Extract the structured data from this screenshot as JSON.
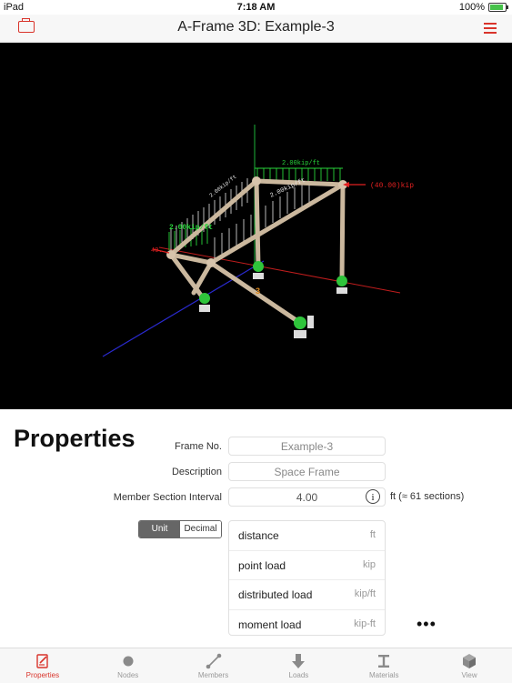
{
  "status_bar": {
    "device": "iPad",
    "time": "7:18 AM",
    "battery": "100%"
  },
  "header": {
    "title": "A-Frame 3D: Example-3",
    "folder_icon": "folder-icon",
    "menu_icon": "hamburger-menu-icon"
  },
  "viewport": {
    "labels": {
      "uniform_load_top": "2.00kip/ft",
      "uniform_load_mid": "2.00kip/ft",
      "uniform_load_left": "2.00kip/ft",
      "left_member_load": "2.00kip/ft",
      "point_load": "(40.00)kip",
      "left_point_load": "40.",
      "member_3": "3"
    }
  },
  "properties": {
    "title": "Properties",
    "frame_no": {
      "label": "Frame No.",
      "value": "Example-3"
    },
    "description": {
      "label": "Description",
      "value": "Space Frame"
    },
    "interval": {
      "label": "Member Section Interval",
      "value": "4.00",
      "info": "i",
      "note": "ft (≈ 61 sections)"
    },
    "format_toggle": {
      "unit": "Unit",
      "decimal": "Decimal",
      "selected": "Unit"
    },
    "units": [
      {
        "name": "distance",
        "unit": "ft"
      },
      {
        "name": "point load",
        "unit": "kip"
      },
      {
        "name": "distributed load",
        "unit": "kip/ft"
      },
      {
        "name": "moment load",
        "unit": "kip-ft"
      }
    ],
    "more": "•••"
  },
  "tabs": [
    {
      "label": "Properties",
      "icon": "edit-document-icon",
      "active": true
    },
    {
      "label": "Nodes",
      "icon": "dot-icon",
      "active": false
    },
    {
      "label": "Members",
      "icon": "member-line-icon",
      "active": false
    },
    {
      "label": "Loads",
      "icon": "down-arrow-icon",
      "active": false
    },
    {
      "label": "Materials",
      "icon": "i-beam-icon",
      "active": false
    },
    {
      "label": "View",
      "icon": "cube-icon",
      "active": false
    }
  ],
  "colors": {
    "accent": "#d9342b",
    "load_green": "#27d43a",
    "point_load_red": "#e02020"
  }
}
